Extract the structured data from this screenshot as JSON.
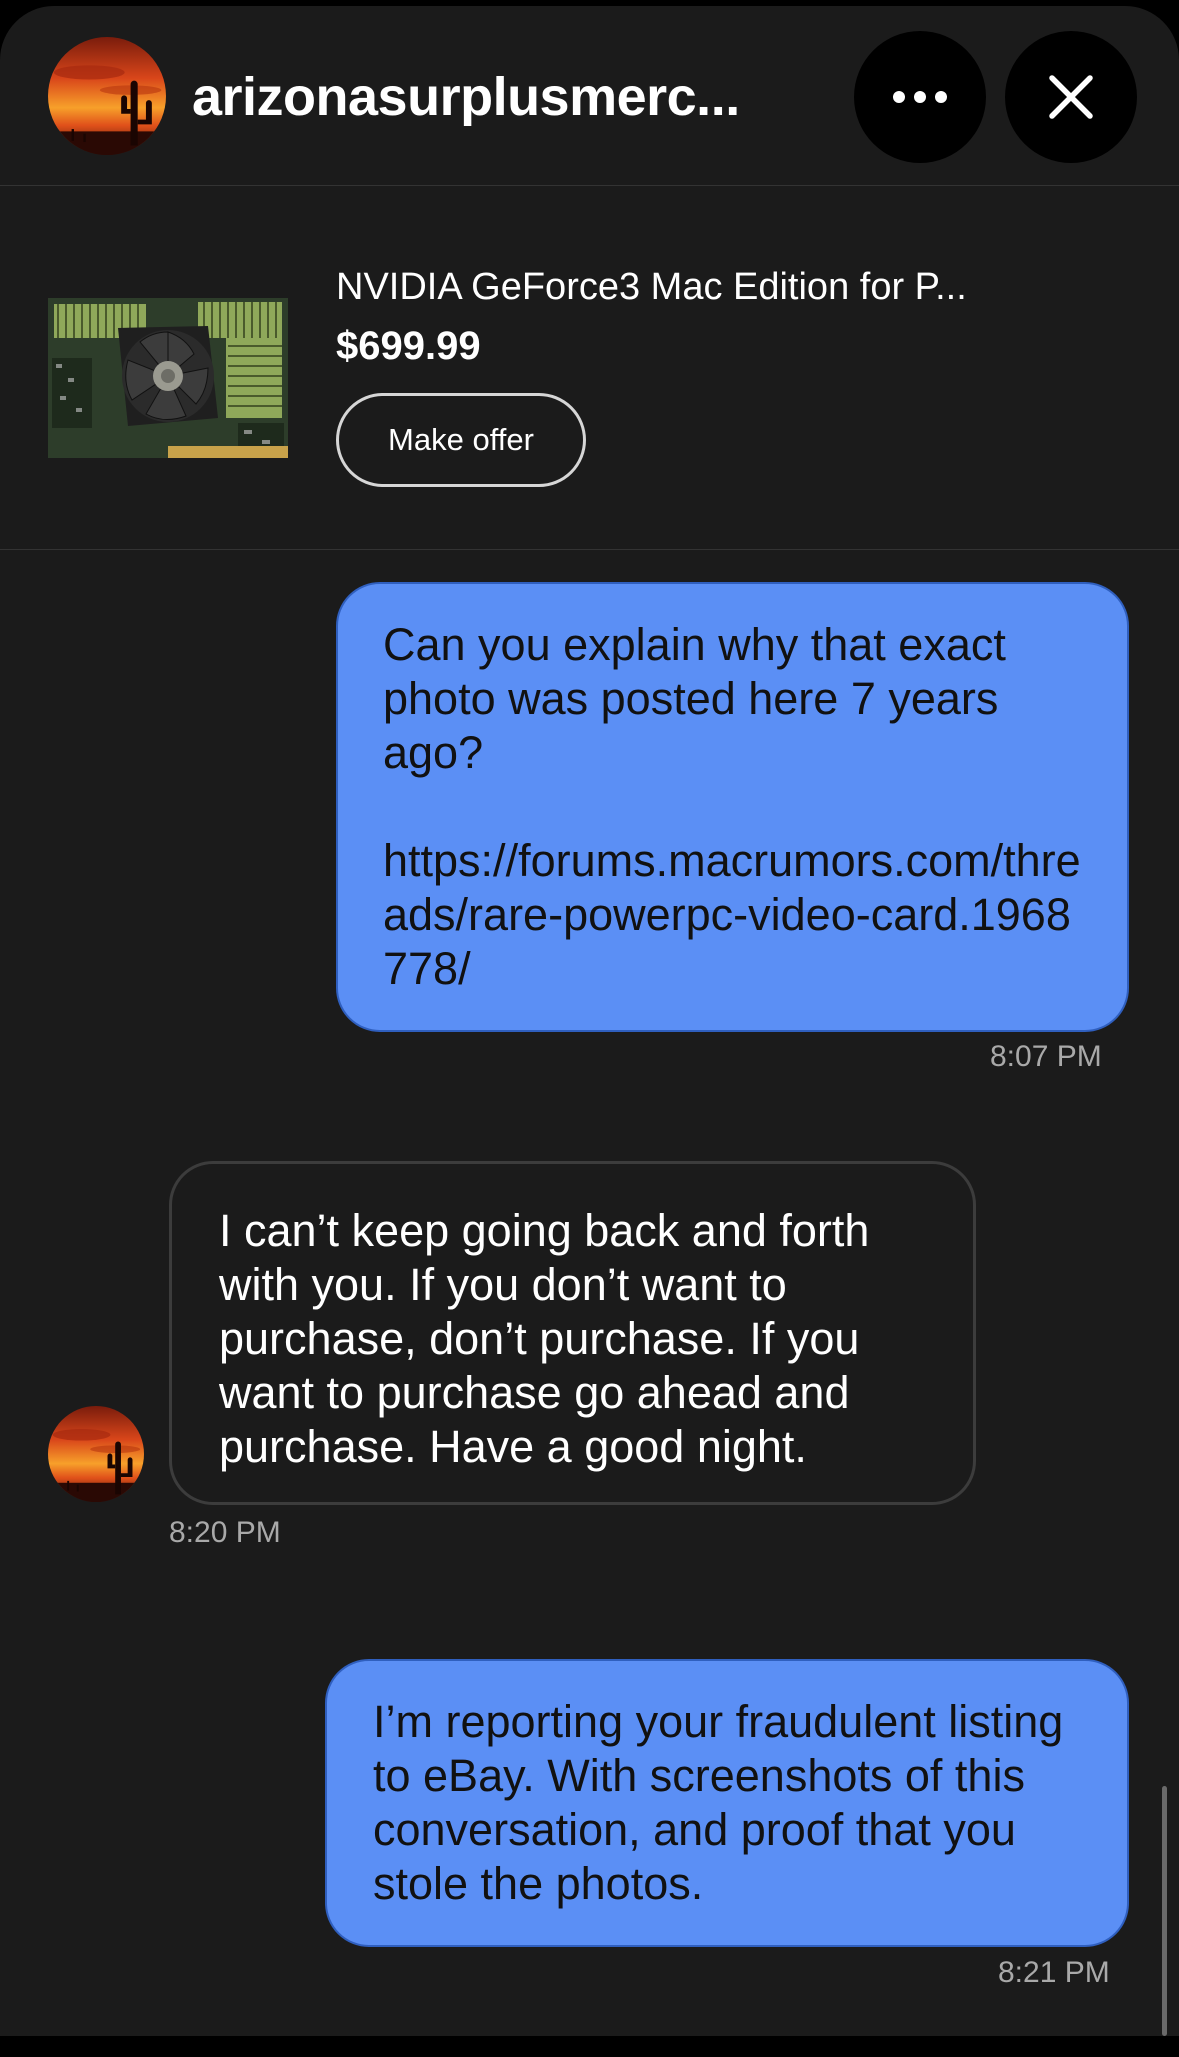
{
  "header": {
    "seller_name": "arizonasurplusmerc...",
    "more_label": "More options",
    "close_label": "Close"
  },
  "listing": {
    "title": "NVIDIA GeForce3 Mac Edition for P...",
    "price": "$699.99",
    "offer_button": "Make offer"
  },
  "messages": [
    {
      "direction": "outgoing",
      "paragraph_1": "Can you explain why that exact photo was posted here 7 years ago?",
      "paragraph_2": "https://forums.macrumors.com/threads/rare-powerpc-video-card.1968778/",
      "time": "8:07 PM"
    },
    {
      "direction": "incoming",
      "text": "I can’t keep going back and forth with you. If you don’t want to purchase, don’t purchase. If you want to purchase go ahead and purchase. Have a good night.",
      "time": "8:20 PM"
    },
    {
      "direction": "outgoing",
      "text": "I’m reporting your fraudulent listing to eBay.  With screenshots of this conversation, and proof that you stole the photos.",
      "time": "8:21 PM"
    }
  ],
  "icons": {
    "more": "more-horizontal-icon",
    "close": "close-icon",
    "avatar": "seller-avatar-desert-sunset"
  },
  "colors": {
    "background": "#1b1b1b",
    "outgoing_bubble": "#5b8ff5",
    "incoming_bubble_border": "#3c3c3c",
    "timestamp": "#a9a9a9"
  }
}
